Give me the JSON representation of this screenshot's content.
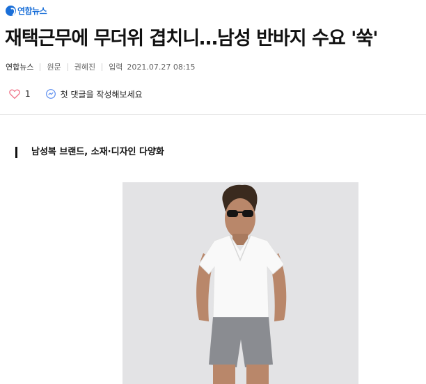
{
  "logo": {
    "text": "연합뉴스"
  },
  "article": {
    "title": "재택근무에 무더위 겹치니…남성 반바지 수요 '쑥'",
    "press": "연합뉴스",
    "original": "원문",
    "reporter": "권혜진",
    "published_label": "입력",
    "published_date": "2021.07.27 08:15",
    "subheading": "남성복 브랜드, 소재·디자인 다양화"
  },
  "actions": {
    "like_count": "1",
    "comment_prompt": "첫 댓글을 작성해보세요"
  },
  "colors": {
    "brand_blue": "#1a6fd8",
    "heart_pink": "#f0788c",
    "comment_blue": "#5b8def",
    "photo_background": "#e3e3e5"
  },
  "icons": [
    "heart-icon",
    "comment-icon"
  ]
}
